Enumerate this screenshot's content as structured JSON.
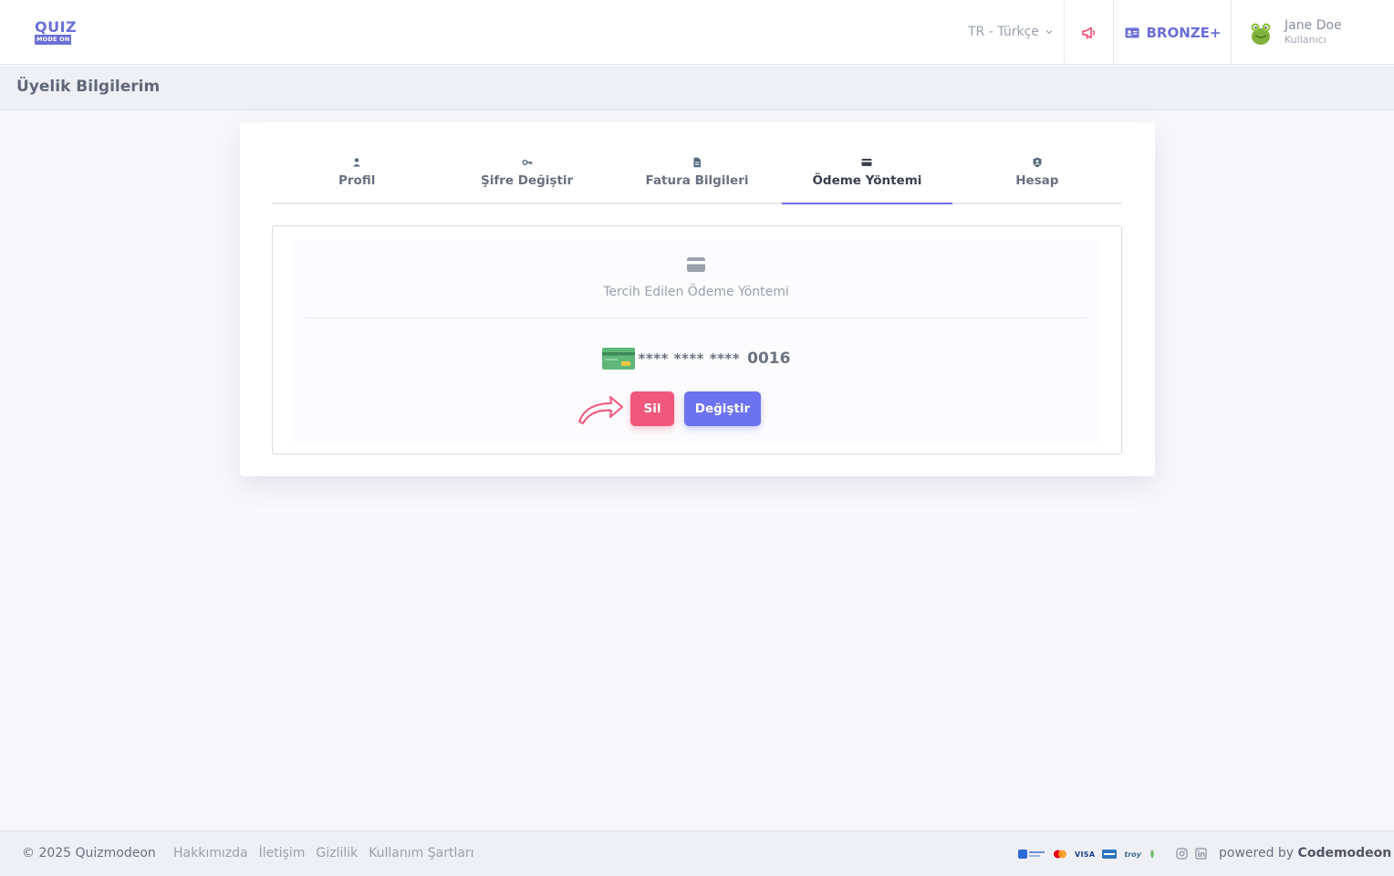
{
  "brand": {
    "logo_top": "QUIZ",
    "logo_bottom": "MODE ON",
    "accent": "#6b6fd6"
  },
  "navbar": {
    "language": "TR - Türkçe",
    "plan": "BRONZE+",
    "user": {
      "name": "Jane Doe",
      "role": "Kullanıcı"
    }
  },
  "page": {
    "title": "Üyelik Bilgilerim"
  },
  "tabs": [
    {
      "label": "Profil",
      "icon": "user-icon"
    },
    {
      "label": "Şifre Değiştir",
      "icon": "key-icon"
    },
    {
      "label": "Fatura Bilgileri",
      "icon": "document-icon"
    },
    {
      "label": "Ödeme Yöntemi",
      "icon": "credit-card-icon",
      "active": true
    },
    {
      "label": "Hesap",
      "icon": "shield-user-icon"
    }
  ],
  "payment": {
    "preferred_label": "Tercih Edilen Ödeme Yöntemi",
    "card_mask": "**** **** ****",
    "card_last4": "0016",
    "delete_label": "Sil",
    "change_label": "Değiştir",
    "delete_color": "#f0587c",
    "change_color": "#6c72f0"
  },
  "footer": {
    "copyright": "© 2025 Quizmodeon",
    "links": [
      "Hakkımızda",
      "İletişim",
      "Gizlilik",
      "Kullanım Şartları"
    ],
    "payment_logos": [
      "iyzico",
      "mastercard",
      "VISA",
      "amex",
      "troy"
    ],
    "powered_prefix": "powered by",
    "powered_brand": "Codemodeon"
  }
}
